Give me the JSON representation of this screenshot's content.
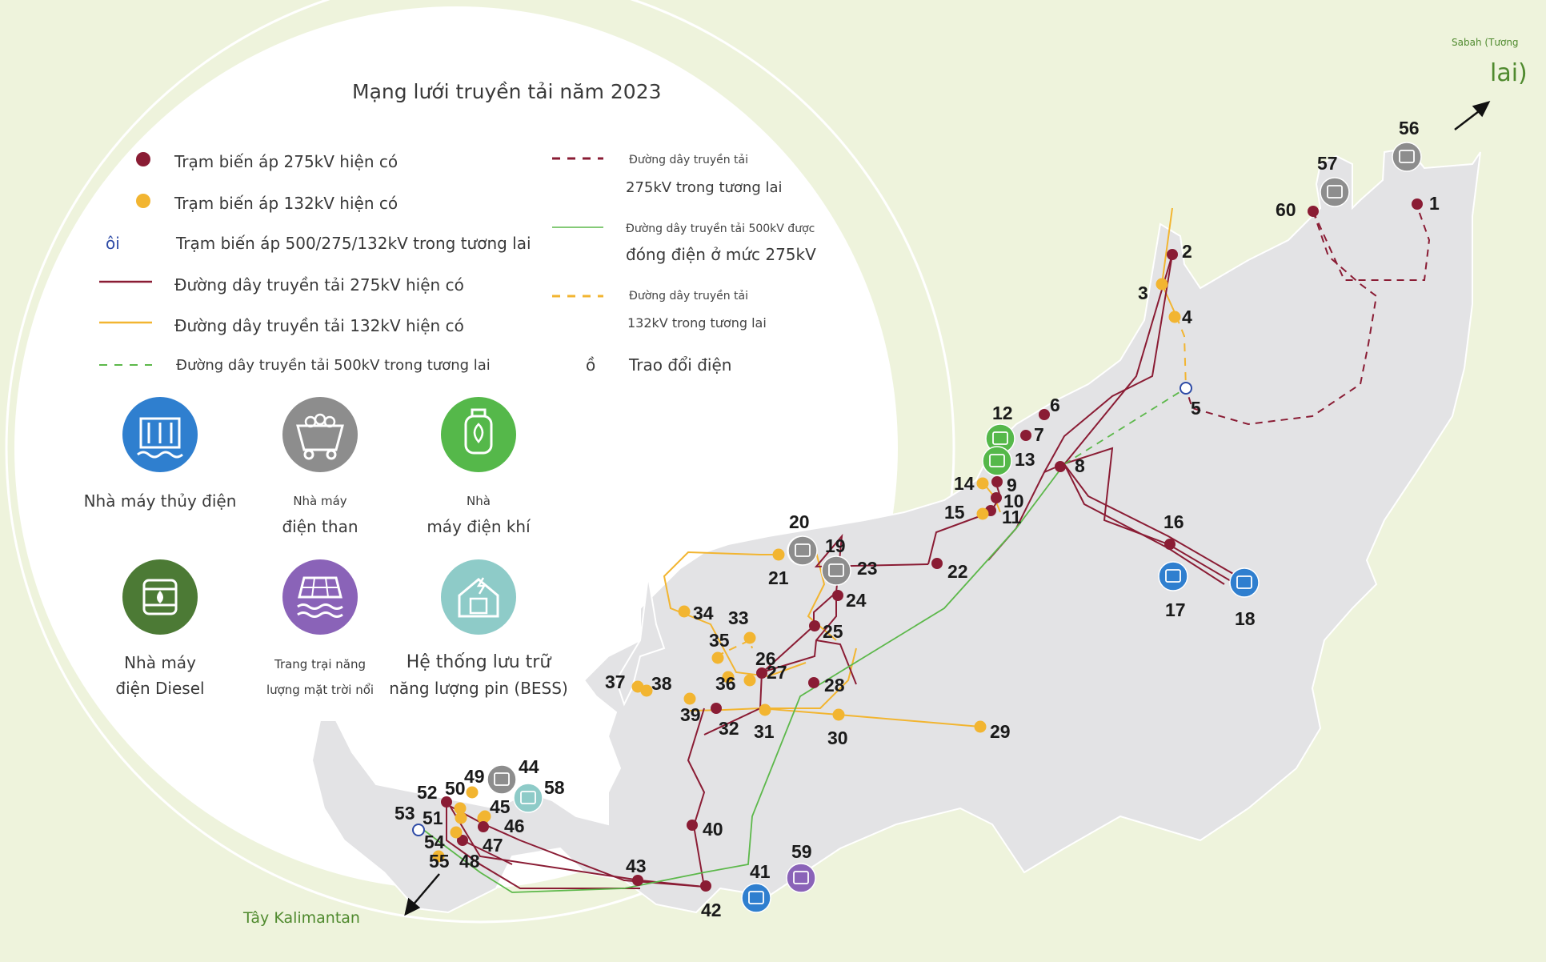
{
  "title": "Mạng lưới truyền tải năm 2023",
  "legend": {
    "sub275": "Trạm biến áp 275kV hiện có",
    "sub132": "Trạm biến áp 132kV hiện có",
    "sub500_glyph": "ôi",
    "sub500": "Trạm biến áp 500/275/132kV trong tương lai",
    "line275": "Đường dây truyền tải 275kV hiện có",
    "line132": "Đường dây truyền tải 132kV hiện có",
    "line500f": "Đường dây truyền tải 500kV trong tương lai",
    "line275f_1": "Đường dây truyền tải",
    "line275f_2": "275kV trong tương lai",
    "line500e_1": "Đường dây truyền tải 500kV được",
    "line500e_2": "đóng điện ở mức 275kV",
    "line132f_1": "Đường dây truyền tải",
    "line132f_2": "132kV trong tương lai",
    "exchange_glyph": "ồ",
    "exchange": "Trao đổi điện"
  },
  "plants": {
    "hydro": "Nhà máy thủy điện",
    "coal_1": "Nhà máy",
    "coal_2": "điện than",
    "gas_1": "Nhà",
    "gas_2": "máy điện khí",
    "diesel_1": "Nhà máy",
    "diesel_2": "điện Diesel",
    "solar_1": "Trang trại năng",
    "solar_2": "lượng mặt trời nổi",
    "bess_1": "Hệ thống lưu trữ",
    "bess_2": "năng lượng pin (BESS)"
  },
  "exports": {
    "sabah_1": "Sabah (Tương",
    "sabah_2": "lai)",
    "kalimantan": "Tây Kalimantan"
  },
  "colors": {
    "sub275": "#8a1c34",
    "sub132": "#f2b531",
    "line500": "#5cb84a",
    "hydro": "#2f7fcf",
    "coal": "#8d8d8d",
    "gas": "#55b84a",
    "diesel": "#4c7a35",
    "solar": "#8a63b8",
    "bess": "#8ecbc8",
    "land": "#e3e3e5",
    "bg": "#eef3dc"
  },
  "labels": [
    "1",
    "2",
    "3",
    "4",
    "5",
    "6",
    "7",
    "8",
    "9",
    "10",
    "11",
    "12",
    "13",
    "14",
    "15",
    "16",
    "17",
    "18",
    "19",
    "20",
    "21",
    "22",
    "23",
    "24",
    "25",
    "26",
    "27",
    "28",
    "29",
    "30",
    "31",
    "32",
    "33",
    "34",
    "35",
    "36",
    "37",
    "38",
    "39",
    "40",
    "41",
    "42",
    "43",
    "44",
    "45",
    "46",
    "47",
    "48",
    "49",
    "50",
    "51",
    "52",
    "53",
    "54",
    "55",
    "56",
    "57",
    "58",
    "59",
    "60"
  ]
}
